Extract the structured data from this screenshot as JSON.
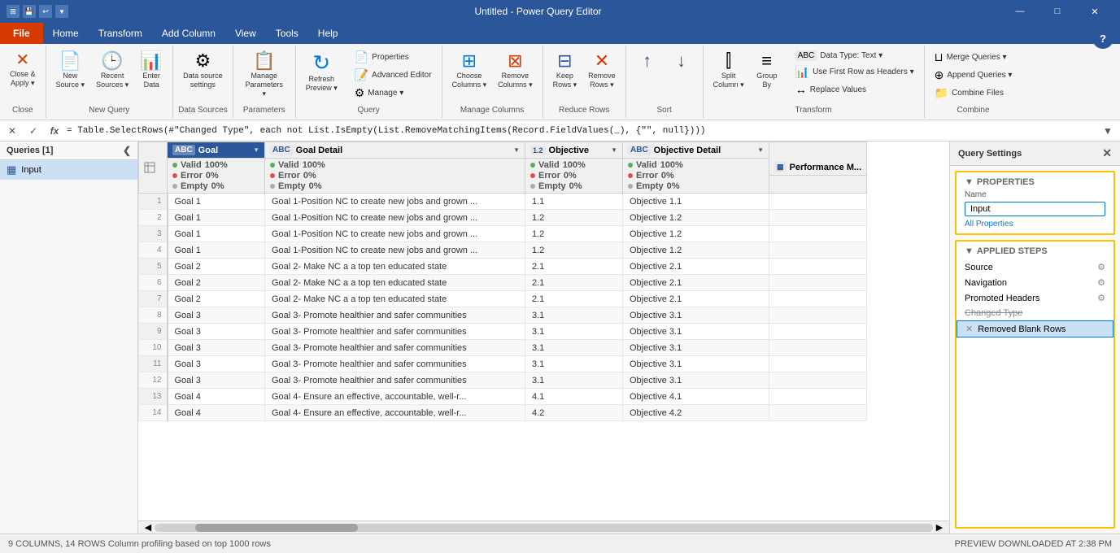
{
  "titleBar": {
    "icons": [
      "⊞",
      "💾",
      "↩"
    ],
    "title": "Untitled - Power Query Editor",
    "controls": [
      "—",
      "□",
      "✕"
    ]
  },
  "menuBar": {
    "fileLabel": "File",
    "items": [
      "Home",
      "Transform",
      "Add Column",
      "View",
      "Tools",
      "Help"
    ]
  },
  "ribbon": {
    "groups": [
      {
        "name": "Close",
        "label": "Close",
        "buttons": [
          {
            "id": "close-apply",
            "label": "Close &\nApply",
            "icon": "✕",
            "dropdown": true
          }
        ]
      },
      {
        "name": "New Query",
        "label": "New Query",
        "buttons": [
          {
            "id": "new-source",
            "label": "New\nSource",
            "icon": "📄",
            "dropdown": true
          },
          {
            "id": "recent-sources",
            "label": "Recent\nSources",
            "icon": "🕒",
            "dropdown": true
          },
          {
            "id": "enter-data",
            "label": "Enter\nData",
            "icon": "⌨"
          }
        ]
      },
      {
        "name": "Data Sources",
        "label": "Data Sources",
        "buttons": [
          {
            "id": "data-source-settings",
            "label": "Data source\nsettings",
            "icon": "⚙"
          }
        ]
      },
      {
        "name": "Parameters",
        "label": "Parameters",
        "buttons": [
          {
            "id": "manage-parameters",
            "label": "Manage\nParameters",
            "icon": "📋",
            "dropdown": true
          }
        ]
      },
      {
        "name": "Query",
        "label": "Query",
        "buttons": [
          {
            "id": "refresh-preview",
            "label": "Refresh\nPreview",
            "icon": "↻",
            "dropdown": true
          }
        ],
        "smallButtons": [
          {
            "id": "properties",
            "label": "Properties",
            "icon": "📄"
          },
          {
            "id": "advanced-editor",
            "label": "Advanced Editor",
            "icon": "📝"
          },
          {
            "id": "manage",
            "label": "Manage",
            "icon": "⚙",
            "dropdown": true
          }
        ]
      },
      {
        "name": "Manage Columns",
        "label": "Manage Columns",
        "buttons": [
          {
            "id": "choose-columns",
            "label": "Choose\nColumns",
            "icon": "⊞",
            "dropdown": true
          },
          {
            "id": "remove-columns",
            "label": "Remove\nColumns",
            "icon": "✕",
            "dropdown": true
          }
        ]
      },
      {
        "name": "Reduce Rows",
        "label": "Reduce Rows",
        "buttons": [
          {
            "id": "keep-rows",
            "label": "Keep\nRows",
            "icon": "⊟",
            "dropdown": true
          },
          {
            "id": "remove-rows",
            "label": "Remove\nRows",
            "icon": "✕",
            "dropdown": true
          }
        ]
      },
      {
        "name": "Sort",
        "label": "Sort",
        "buttons": [
          {
            "id": "sort-asc",
            "label": "↑",
            "icon": "↑"
          },
          {
            "id": "sort-desc",
            "label": "↓",
            "icon": "↓"
          }
        ]
      },
      {
        "name": "Transform",
        "label": "Transform",
        "buttons": [
          {
            "id": "split-column",
            "label": "Split\nColumn",
            "icon": "⫿",
            "dropdown": true
          },
          {
            "id": "group-by",
            "label": "Group\nBy",
            "icon": "≡"
          },
          {
            "id": "data-type",
            "label": "Data Type: Text",
            "icon": "A",
            "dropdown": true
          }
        ],
        "smallButtons": [
          {
            "id": "use-first-row",
            "label": "Use First Row as Headers",
            "icon": "↑",
            "dropdown": true
          },
          {
            "id": "replace-values",
            "label": "Replace Values",
            "icon": "↔"
          }
        ]
      },
      {
        "name": "Combine",
        "label": "Combine",
        "smallButtons": [
          {
            "id": "merge-queries",
            "label": "Merge Queries",
            "icon": "⊔",
            "dropdown": true
          },
          {
            "id": "append-queries",
            "label": "Append Queries",
            "icon": "+",
            "dropdown": true
          },
          {
            "id": "combine-files",
            "label": "Combine Files",
            "icon": "📁"
          }
        ]
      }
    ]
  },
  "formulaBar": {
    "cancelBtn": "✕",
    "acceptBtn": "✓",
    "fxBtn": "fx",
    "formula": "= Table.SelectRows(#\"Changed Type\", each not List.IsEmpty(List.RemoveMatchingItems(Record.FieldValues(_), {\"\", null})))"
  },
  "queriesPanel": {
    "title": "Queries [1]",
    "collapseIcon": "❮",
    "items": [
      {
        "id": "input-query",
        "icon": "▦",
        "label": "Input",
        "active": true
      }
    ]
  },
  "dataGrid": {
    "columns": [
      {
        "id": "goal",
        "type": "ABC",
        "name": "Goal",
        "selected": true,
        "stats": {
          "valid": "100%",
          "error": "0%",
          "empty": "0%"
        }
      },
      {
        "id": "goal-detail",
        "type": "ABC",
        "name": "Goal Detail",
        "selected": false,
        "stats": {
          "valid": "100%",
          "error": "0%",
          "empty": "0%"
        }
      },
      {
        "id": "objective",
        "type": "1.2",
        "name": "Objective",
        "selected": false,
        "stats": {
          "valid": "100%",
          "error": "0%",
          "empty": "0%"
        }
      },
      {
        "id": "objective-detail",
        "type": "ABC",
        "name": "Objective Detail",
        "selected": false,
        "stats": {
          "valid": "100%",
          "error": "0%",
          "empty": "0%"
        }
      },
      {
        "id": "performance-m",
        "type": "▦",
        "name": "Performance M...",
        "selected": false,
        "stats": {
          "valid": "",
          "error": "",
          "empty": ""
        }
      }
    ],
    "rows": [
      {
        "rowNum": 1,
        "goal": "Goal 1",
        "goalDetail": "Goal 1-Position NC to create new jobs and grown ...",
        "objective": "1.1",
        "objectiveDetail": "Objective 1.1",
        "perfM": ""
      },
      {
        "rowNum": 2,
        "goal": "Goal 1",
        "goalDetail": "Goal 1-Position NC to create new jobs and grown ...",
        "objective": "1.2",
        "objectiveDetail": "Objective 1.2",
        "perfM": ""
      },
      {
        "rowNum": 3,
        "goal": "Goal 1",
        "goalDetail": "Goal 1-Position NC to create new jobs and grown ...",
        "objective": "1.2",
        "objectiveDetail": "Objective 1.2",
        "perfM": ""
      },
      {
        "rowNum": 4,
        "goal": "Goal 1",
        "goalDetail": "Goal 1-Position NC to create new jobs and grown ...",
        "objective": "1.2",
        "objectiveDetail": "Objective 1.2",
        "perfM": ""
      },
      {
        "rowNum": 5,
        "goal": "Goal 2",
        "goalDetail": "Goal 2- Make NC a a top ten educated state",
        "objective": "2.1",
        "objectiveDetail": "Objective 2.1",
        "perfM": ""
      },
      {
        "rowNum": 6,
        "goal": "Goal 2",
        "goalDetail": "Goal 2- Make NC a a top ten educated state",
        "objective": "2.1",
        "objectiveDetail": "Objective 2.1",
        "perfM": ""
      },
      {
        "rowNum": 7,
        "goal": "Goal 2",
        "goalDetail": "Goal 2- Make NC a a top ten educated state",
        "objective": "2.1",
        "objectiveDetail": "Objective 2.1",
        "perfM": ""
      },
      {
        "rowNum": 8,
        "goal": "Goal 3",
        "goalDetail": "Goal 3- Promote healthier and safer communities",
        "objective": "3.1",
        "objectiveDetail": "Objective 3.1",
        "perfM": ""
      },
      {
        "rowNum": 9,
        "goal": "Goal 3",
        "goalDetail": "Goal 3- Promote healthier and safer communities",
        "objective": "3.1",
        "objectiveDetail": "Objective 3.1",
        "perfM": ""
      },
      {
        "rowNum": 10,
        "goal": "Goal 3",
        "goalDetail": "Goal 3- Promote healthier and safer communities",
        "objective": "3.1",
        "objectiveDetail": "Objective 3.1",
        "perfM": ""
      },
      {
        "rowNum": 11,
        "goal": "Goal 3",
        "goalDetail": "Goal 3- Promote healthier and safer communities",
        "objective": "3.1",
        "objectiveDetail": "Objective 3.1",
        "perfM": ""
      },
      {
        "rowNum": 12,
        "goal": "Goal 3",
        "goalDetail": "Goal 3- Promote healthier and safer communities",
        "objective": "3.1",
        "objectiveDetail": "Objective 3.1",
        "perfM": ""
      },
      {
        "rowNum": 13,
        "goal": "Goal 4",
        "goalDetail": "Goal 4- Ensure an effective, accountable, well-r...",
        "objective": "4.1",
        "objectiveDetail": "Objective 4.1",
        "perfM": ""
      },
      {
        "rowNum": 14,
        "goal": "Goal 4",
        "goalDetail": "Goal 4- Ensure an effective, accountable, well-r...",
        "objective": "4.2",
        "objectiveDetail": "Objective 4.2",
        "perfM": ""
      }
    ]
  },
  "querySettings": {
    "title": "Query Settings",
    "closeBtn": "✕",
    "propertiesLabel": "PROPERTIES",
    "nameLabel": "Name",
    "nameValue": "Input",
    "allPropertiesLink": "All Properties",
    "appliedStepsLabel": "APPLIED STEPS",
    "steps": [
      {
        "id": "source",
        "label": "Source",
        "hasGear": true,
        "active": false,
        "strikethrough": false
      },
      {
        "id": "navigation",
        "label": "Navigation",
        "hasGear": true,
        "active": false,
        "strikethrough": false
      },
      {
        "id": "promoted-headers",
        "label": "Promoted Headers",
        "hasGear": true,
        "active": false,
        "strikethrough": false
      },
      {
        "id": "changed-type",
        "label": "Changed Type",
        "hasGear": false,
        "active": false,
        "strikethrough": true
      },
      {
        "id": "removed-blank-rows",
        "label": "Removed Blank Rows",
        "hasGear": false,
        "active": true,
        "hasX": true,
        "strikethrough": false
      }
    ]
  },
  "statusBar": {
    "left": "9 COLUMNS, 14 ROWS   Column profiling based on top 1000 rows",
    "right": "PREVIEW DOWNLOADED AT 2:38 PM"
  }
}
